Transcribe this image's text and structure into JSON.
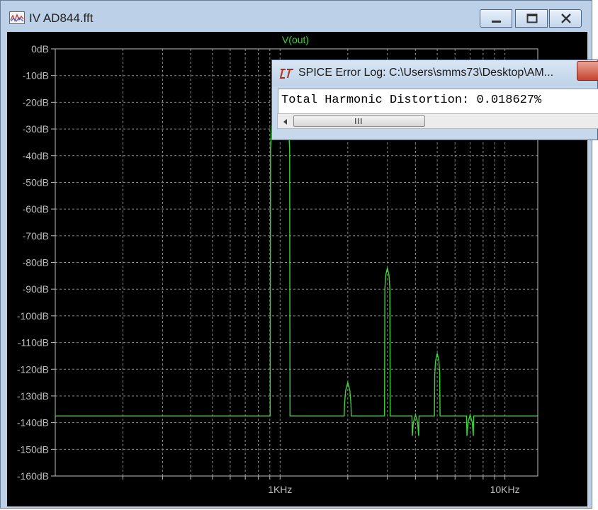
{
  "window": {
    "title": "IV AD844.fft"
  },
  "plot": {
    "trace_label": "V(out)",
    "trace_color": "#39d535",
    "background": "#000000"
  },
  "error_log": {
    "title": "SPICE Error Log: C:\\Users\\smms73\\Desktop\\AM...",
    "content": "Total Harmonic Distortion: 0.018627%"
  },
  "chart_data": {
    "type": "line",
    "title": "V(out)",
    "xlabel": "",
    "ylabel": "",
    "x_scale": "log",
    "y_ticks": [
      "0dB",
      "-10dB",
      "-20dB",
      "-30dB",
      "-40dB",
      "-50dB",
      "-60dB",
      "-70dB",
      "-80dB",
      "-90dB",
      "-100dB",
      "-110dB",
      "-120dB",
      "-130dB",
      "-140dB",
      "-150dB",
      "-160dB"
    ],
    "x_ticks": [
      "1KHz",
      "10KHz"
    ],
    "x_range": [
      100,
      14000
    ],
    "y_range": [
      -160,
      0
    ],
    "grid": true,
    "noise_floor_db": -137.5,
    "peaks": [
      {
        "freq_hz": 1000,
        "db": -7.5
      },
      {
        "freq_hz": 2000,
        "db": -125
      },
      {
        "freq_hz": 3000,
        "db": -82
      },
      {
        "freq_hz": 4000,
        "db": -137
      },
      {
        "freq_hz": 5000,
        "db": -114
      },
      {
        "freq_hz": 7000,
        "db": -137
      }
    ]
  }
}
